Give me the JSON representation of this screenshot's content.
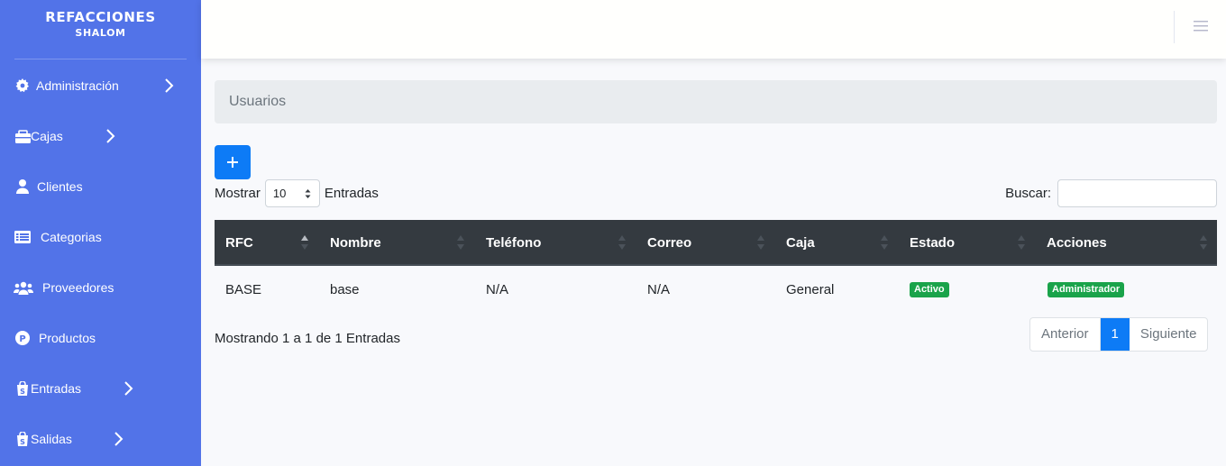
{
  "brand": {
    "title": "REFACCIONES",
    "subtitle": "SHALOM"
  },
  "sidebar": {
    "items": [
      {
        "label": "Administración",
        "icon": "gear-icon",
        "chevron": true
      },
      {
        "label": "Cajas",
        "icon": "cash-register-icon",
        "chevron": true
      },
      {
        "label": "Clientes",
        "icon": "user-icon",
        "chevron": false
      },
      {
        "label": "Categorias",
        "icon": "list-icon",
        "chevron": false
      },
      {
        "label": "Proveedores",
        "icon": "users-icon",
        "chevron": false
      },
      {
        "label": "Productos",
        "icon": "product-icon",
        "chevron": false
      },
      {
        "label": "Entradas",
        "icon": "shopping-bag-icon",
        "chevron": true
      },
      {
        "label": "Salidas",
        "icon": "shopping-bag-icon",
        "chevron": true
      }
    ]
  },
  "breadcrumb": {
    "current": "Usuarios"
  },
  "toolbar": {
    "add_label": "+"
  },
  "length": {
    "prefix": "Mostrar",
    "value": "10",
    "suffix": "Entradas"
  },
  "search": {
    "label": "Buscar:",
    "value": ""
  },
  "table": {
    "columns": [
      "RFC",
      "Nombre",
      "Teléfono",
      "Correo",
      "Caja",
      "Estado",
      "Acciones"
    ],
    "rows": [
      {
        "rfc": "BASE",
        "nombre": "base",
        "telefono": "N/A",
        "correo": "N/A",
        "caja": "General",
        "estado": "Activo",
        "acciones": "Administrador"
      }
    ]
  },
  "info": "Mostrando 1 a 1 de 1 Entradas",
  "pagination": {
    "prev": "Anterior",
    "current": "1",
    "next": "Siguiente"
  },
  "colors": {
    "sidebar": "#5273e8",
    "primary": "#0d7bf6",
    "success": "#1aa34a",
    "table_header": "#343a40"
  }
}
